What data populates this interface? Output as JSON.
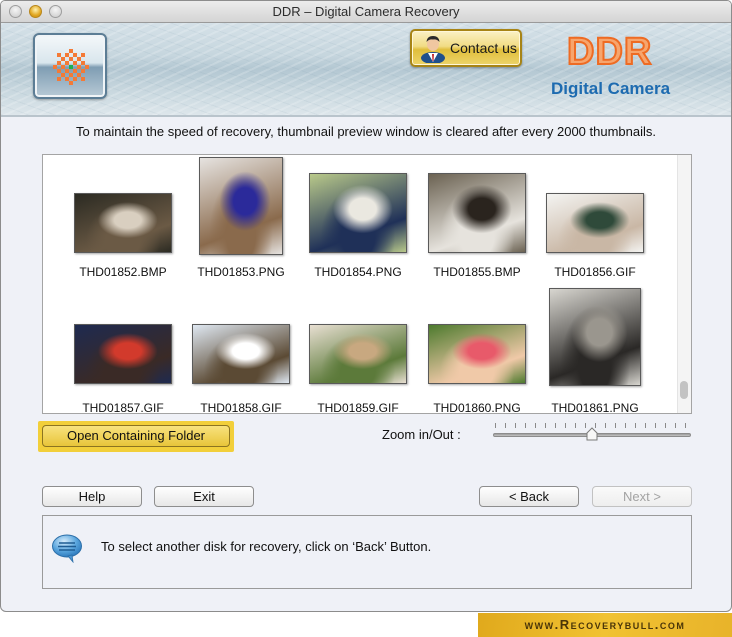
{
  "window": {
    "title": "DDR – Digital Camera Recovery"
  },
  "header": {
    "contact_label": "Contact us",
    "brand": "DDR",
    "brand_sub": "Digital Camera",
    "colors": {
      "brand_fill": "#f7a56d",
      "brand_stroke": "#ee6b23",
      "brand_sub": "#1d6bb0"
    }
  },
  "notice": "To maintain the speed of recovery, thumbnail preview window is cleared after every 2000 thumbnails.",
  "thumbnails": [
    {
      "name": "THD01852.BMP",
      "shape": "landscape",
      "palette": [
        "#2b2a22",
        "#6b5a45",
        "#d9cfc0"
      ]
    },
    {
      "name": "THD01853.PNG",
      "shape": "portrait",
      "palette": [
        "#e6e3e0",
        "#8a6a4c",
        "#2b2a9a"
      ]
    },
    {
      "name": "THD01854.PNG",
      "shape": "landscape-tall",
      "palette": [
        "#b9c98a",
        "#1f3058",
        "#eae8e0"
      ]
    },
    {
      "name": "THD01855.BMP",
      "shape": "landscape-tall",
      "palette": [
        "#6b6252",
        "#e6e3dd",
        "#2a241e"
      ]
    },
    {
      "name": "THD01856.GIF",
      "shape": "landscape",
      "palette": [
        "#f4f4f2",
        "#c9b7a5",
        "#2f4a3a"
      ]
    },
    {
      "name": "THD01857.GIF",
      "shape": "landscape",
      "palette": [
        "#1e2a50",
        "#3a2a26",
        "#d23a2c"
      ]
    },
    {
      "name": "THD01858.GIF",
      "shape": "landscape",
      "palette": [
        "#dfe8f2",
        "#5b4a34",
        "#ffffff"
      ]
    },
    {
      "name": "THD01859.GIF",
      "shape": "landscape",
      "palette": [
        "#e8dfd2",
        "#5c7a3a",
        "#c8a880"
      ]
    },
    {
      "name": "THD01860.PNG",
      "shape": "landscape",
      "palette": [
        "#4d7a2e",
        "#f0c9a8",
        "#e85a6a"
      ]
    },
    {
      "name": "THD01861.PNG",
      "shape": "portrait-large",
      "palette": [
        "#d8d6d0",
        "#2a2826",
        "#9a968e"
      ]
    }
  ],
  "scroll": {
    "position_fraction": 0.95
  },
  "actions": {
    "open_folder_label": "Open Containing Folder",
    "zoom_label": "Zoom in/Out :",
    "zoom_fraction": 0.5,
    "zoom_ticks": 20
  },
  "nav": {
    "help_label": "Help",
    "exit_label": "Exit",
    "back_label": "< Back",
    "next_label": "Next >",
    "next_enabled": false
  },
  "status": {
    "message": "To select another disk for recovery, click on ‘Back’ Button."
  },
  "footer": {
    "url": "www.Recoverybull.com"
  }
}
